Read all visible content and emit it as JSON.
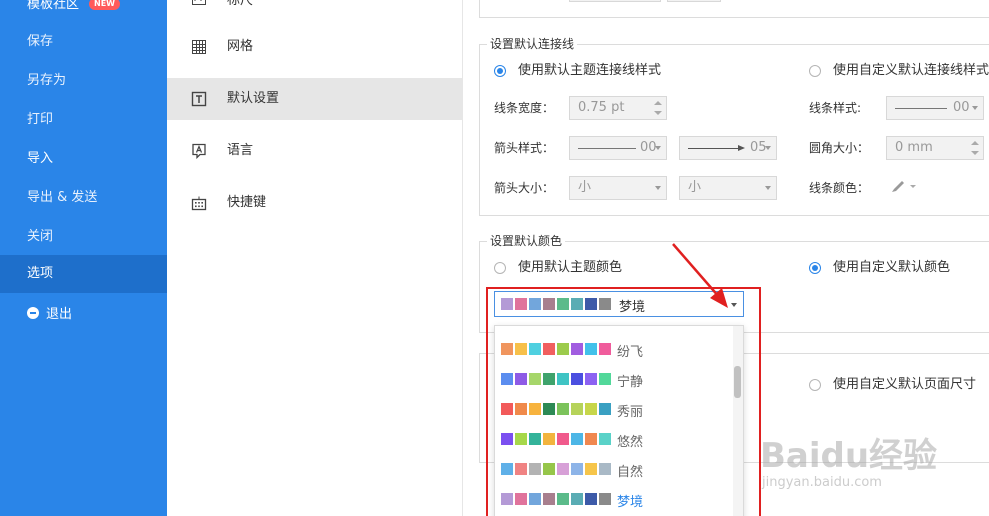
{
  "left_menu": {
    "items": [
      {
        "label": "模板社区",
        "badge": "NEW"
      },
      {
        "label": "保存"
      },
      {
        "label": "另存为"
      },
      {
        "label": "打印"
      },
      {
        "label": "导入"
      },
      {
        "label": "导出 & 发送"
      },
      {
        "label": "关闭"
      },
      {
        "label": "选项"
      },
      {
        "label": "退出"
      }
    ],
    "active": "选项"
  },
  "settings_nav": {
    "items": [
      {
        "label": "标尺",
        "icon": "ruler-icon"
      },
      {
        "label": "网格",
        "icon": "grid-icon"
      },
      {
        "label": "默认设置",
        "icon": "text-box-icon"
      },
      {
        "label": "语言",
        "icon": "language-icon"
      },
      {
        "label": "快捷键",
        "icon": "keyboard-icon"
      }
    ],
    "active": "默认设置"
  },
  "connector_section": {
    "title": "设置默认连接线",
    "radio_theme": "使用默认主题连接线样式",
    "radio_custom": "使用自定义默认连接线样式",
    "line_width_label": "线条宽度：",
    "line_width_value": "0.75 pt",
    "line_style_label": "线条样式:",
    "line_style_value": "00",
    "arrow_style_label": "箭头样式：",
    "arrow_start_value": "00",
    "arrow_end_value": "05",
    "corner_label": "圆角大小：",
    "corner_value": "0 mm",
    "arrow_size_label": "箭头大小：",
    "arrow_size_start": "小",
    "arrow_size_end": "小",
    "line_color_label": "线条颜色："
  },
  "color_section": {
    "title": "设置默认颜色",
    "radio_theme": "使用默认主题颜色",
    "radio_custom": "使用自定义默认颜色",
    "selected_value": "梦境"
  },
  "page_section": {
    "radio_custom": "使用自定义默认页面尺寸"
  },
  "color_options": [
    {
      "name": "纷飞",
      "colors": [
        "#f0955e",
        "#f7c04a",
        "#4fd0e0",
        "#f15f5f",
        "#9ccb4c",
        "#a15de0",
        "#42c1ea",
        "#f05c9c"
      ]
    },
    {
      "name": "宁静",
      "colors": [
        "#5b8def",
        "#8e5be6",
        "#a6d66a",
        "#3fa36c",
        "#3fc4c4",
        "#4b4fe0",
        "#8c62f2",
        "#52d89a"
      ]
    },
    {
      "name": "秀丽",
      "colors": [
        "#f25a5a",
        "#f08a4b",
        "#f7b33e",
        "#2d8a55",
        "#7cc35b",
        "#b6d35a",
        "#c7d64a",
        "#3aa0c2"
      ]
    },
    {
      "name": "悠然",
      "colors": [
        "#7b4ff0",
        "#a6d84a",
        "#34b39a",
        "#f2b43e",
        "#f05a8c",
        "#4db6e6",
        "#f08850",
        "#5ad2c8"
      ]
    },
    {
      "name": "自然",
      "colors": [
        "#5fb0e8",
        "#f08383",
        "#b3b3b3",
        "#96c64a",
        "#d7a0d7",
        "#8db4e8",
        "#f6c54a",
        "#a9b9c6"
      ]
    },
    {
      "name": "梦境",
      "colors": [
        "#b49ad6",
        "#e0739c",
        "#72a6dc",
        "#a87f8e",
        "#5bbb8a",
        "#5aacb4",
        "#3d5aa8",
        "#8a8a8a"
      ]
    }
  ],
  "watermark": {
    "text": "Baidu经验",
    "url": "jingyan.baidu.com"
  }
}
